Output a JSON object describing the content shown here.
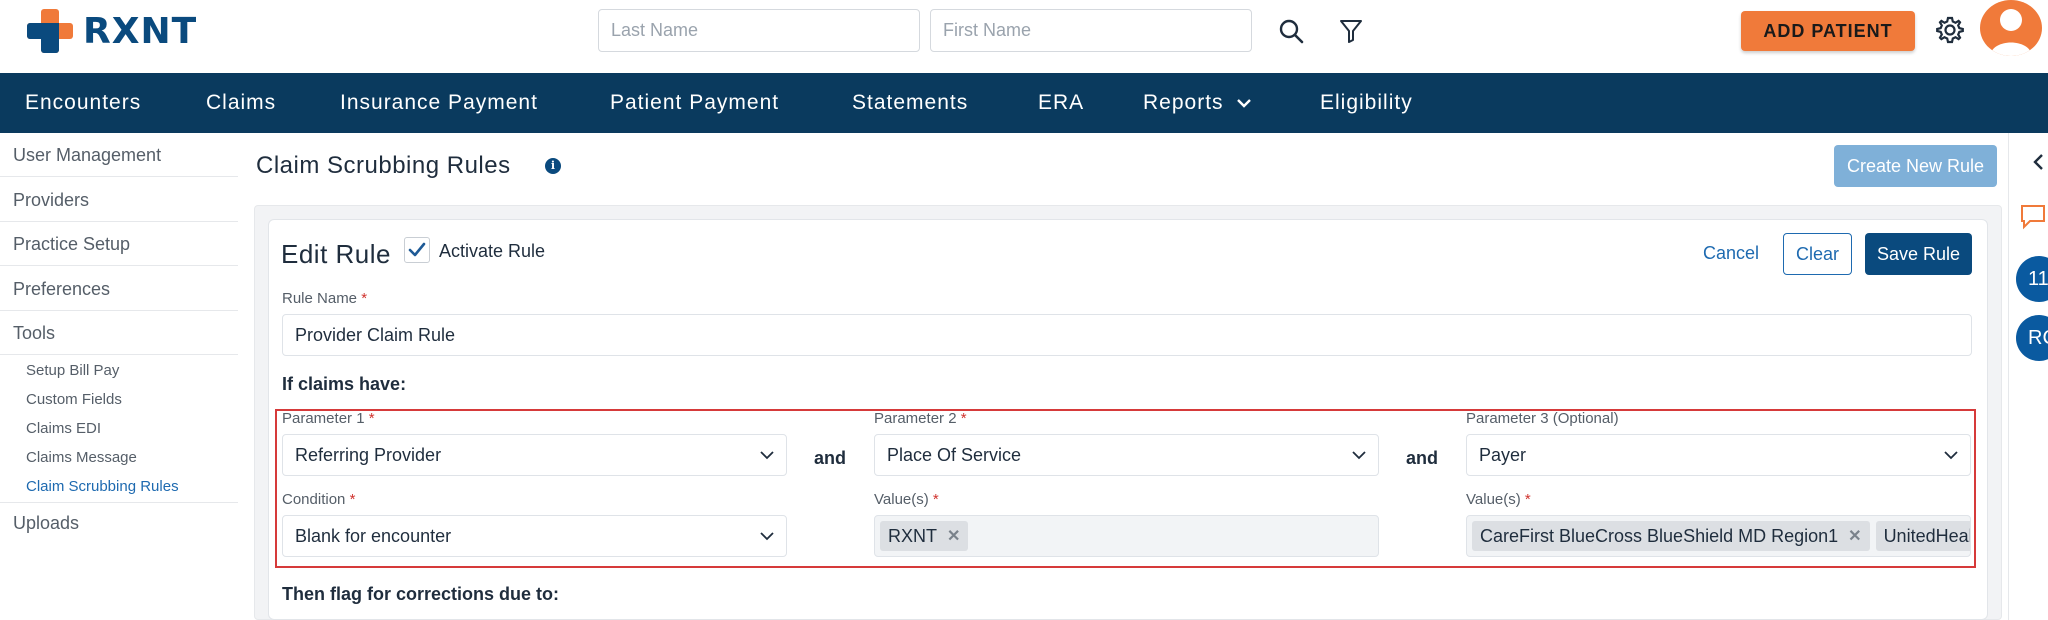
{
  "header": {
    "logo_text": "RXNT",
    "last_name_placeholder": "Last Name",
    "first_name_placeholder": "First Name",
    "add_patient_label": "ADD PATIENT"
  },
  "nav": {
    "items": [
      "Encounters",
      "Claims",
      "Insurance Payment",
      "Patient Payment",
      "Statements",
      "ERA",
      "Reports",
      "Eligibility"
    ]
  },
  "sidebar": {
    "main_items": [
      "User Management",
      "Providers",
      "Practice Setup",
      "Preferences",
      "Tools"
    ],
    "tools_subitems": [
      "Setup Bill Pay",
      "Custom Fields",
      "Claims EDI",
      "Claims Message",
      "Claim Scrubbing Rules"
    ],
    "uploads": "Uploads"
  },
  "page": {
    "title": "Claim Scrubbing Rules",
    "create_button": "Create New Rule"
  },
  "edit_rule": {
    "title": "Edit Rule",
    "activate_label": "Activate Rule",
    "activate_checked": true,
    "cancel_label": "Cancel",
    "clear_label": "Clear",
    "save_label": "Save Rule",
    "rule_name_label": "Rule Name",
    "rule_name_value": "Provider Claim Rule",
    "if_claims_label": "If claims have:",
    "param1_label": "Parameter 1",
    "param1_value": "Referring Provider",
    "and_label": "and",
    "param2_label": "Parameter 2",
    "param2_value": "Place Of Service",
    "param3_label": "Parameter 3 (Optional)",
    "param3_value": "Payer",
    "condition_label": "Condition",
    "condition_value": "Blank for encounter",
    "values2_label": "Value(s)",
    "values2_chips": [
      "RXNT"
    ],
    "values3_label": "Value(s)",
    "values3_chips": [
      "CareFirst BlueCross BlueShield MD Region1",
      "UnitedHealt"
    ],
    "then_flag_label": "Then flag for corrections due to:"
  },
  "right_rail": {
    "badge1": "11",
    "badge2": "RC"
  },
  "colors": {
    "brand_orange": "#f07a3a",
    "brand_navy": "#0a3a5e",
    "link_blue": "#1e6ab0",
    "highlight_red": "#d63a3a"
  }
}
